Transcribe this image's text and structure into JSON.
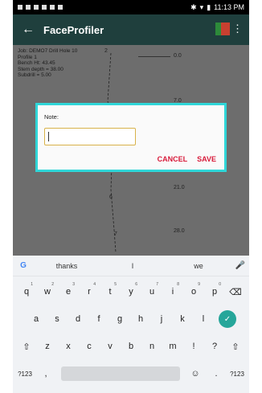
{
  "status_bar": {
    "time": "11:13 PM"
  },
  "app_bar": {
    "back_icon": "back-arrow-icon",
    "title": "FaceProfiler",
    "flag_icon": "flag-icon",
    "menu_icon": "overflow-menu-icon"
  },
  "info_block": {
    "line1": "Job: DEMO7 Drill Hole 10",
    "line2": "Profile 1",
    "line3": "Bench Ht: 43.45",
    "line4": "Stem depth = 38.00",
    "line5": "Subdrill = 5.00"
  },
  "profile_labels": {
    "p2": "2",
    "p6": "6",
    "p7": "7"
  },
  "depth_labels": {
    "d0": "0.0",
    "d7": "7.0",
    "d21": "21.0",
    "d28": "28.0"
  },
  "dialog": {
    "label": "Note:",
    "input_value": "",
    "cancel_label": "CANCEL",
    "save_label": "SAVE",
    "accent_color": "#2fd6d8",
    "button_color": "#d81b3a"
  },
  "keyboard": {
    "suggestions": [
      "thanks",
      "I",
      "we"
    ],
    "row1": [
      {
        "key": "q",
        "hint": "1"
      },
      {
        "key": "w",
        "hint": "2"
      },
      {
        "key": "e",
        "hint": "3"
      },
      {
        "key": "r",
        "hint": "4"
      },
      {
        "key": "t",
        "hint": "5"
      },
      {
        "key": "y",
        "hint": "6"
      },
      {
        "key": "u",
        "hint": "7"
      },
      {
        "key": "i",
        "hint": "8"
      },
      {
        "key": "o",
        "hint": "9"
      },
      {
        "key": "p",
        "hint": "0"
      }
    ],
    "row2": [
      "a",
      "s",
      "d",
      "f",
      "g",
      "h",
      "j",
      "k",
      "l"
    ],
    "row3": [
      "z",
      "x",
      "c",
      "v",
      "b",
      "n",
      "m",
      "!",
      "?"
    ],
    "symbols_key": "?123",
    "comma_key": ",",
    "period_key": ".",
    "emoji_icon": "emoji-icon",
    "enter_icon": "checkmark-icon",
    "backspace_icon": "backspace-icon",
    "shift_icon": "shift-icon",
    "mic_icon": "mic-icon",
    "google_icon": "google-g-icon"
  }
}
